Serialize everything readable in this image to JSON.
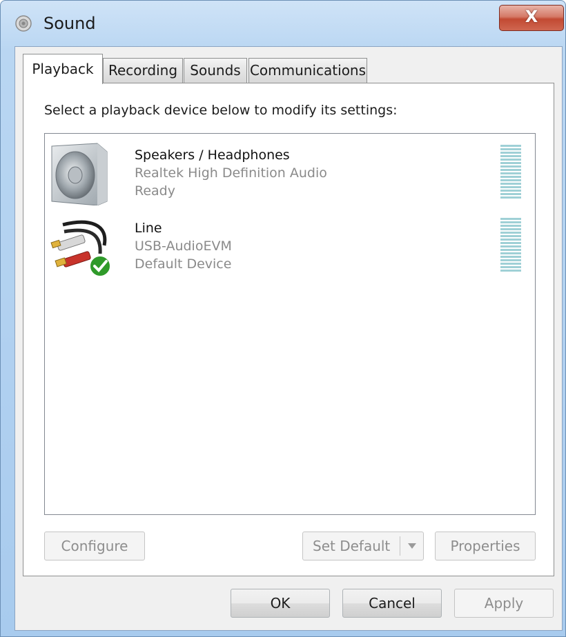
{
  "window": {
    "title": "Sound",
    "close_label": "X"
  },
  "tabs": [
    {
      "label": "Playback",
      "active": true
    },
    {
      "label": "Recording",
      "active": false
    },
    {
      "label": "Sounds",
      "active": false
    },
    {
      "label": "Communications",
      "active": false
    }
  ],
  "playback": {
    "instruction": "Select a playback device below to modify its settings:",
    "devices": [
      {
        "name": "Speakers / Headphones",
        "driver": "Realtek High Definition Audio",
        "status": "Ready",
        "icon": "speaker-icon"
      },
      {
        "name": "Line",
        "driver": "USB-AudioEVM",
        "status": "Default Device",
        "icon": "rca-cable-icon",
        "is_default": true
      }
    ]
  },
  "panel_buttons": {
    "configure": "Configure",
    "set_default": "Set Default",
    "properties": "Properties"
  },
  "dialog_buttons": {
    "ok": "OK",
    "cancel": "Cancel",
    "apply": "Apply"
  },
  "colors": {
    "meter": "#9fd0d6",
    "default_check": "#2f9a2a",
    "title_bar": "#b9d6f2"
  }
}
